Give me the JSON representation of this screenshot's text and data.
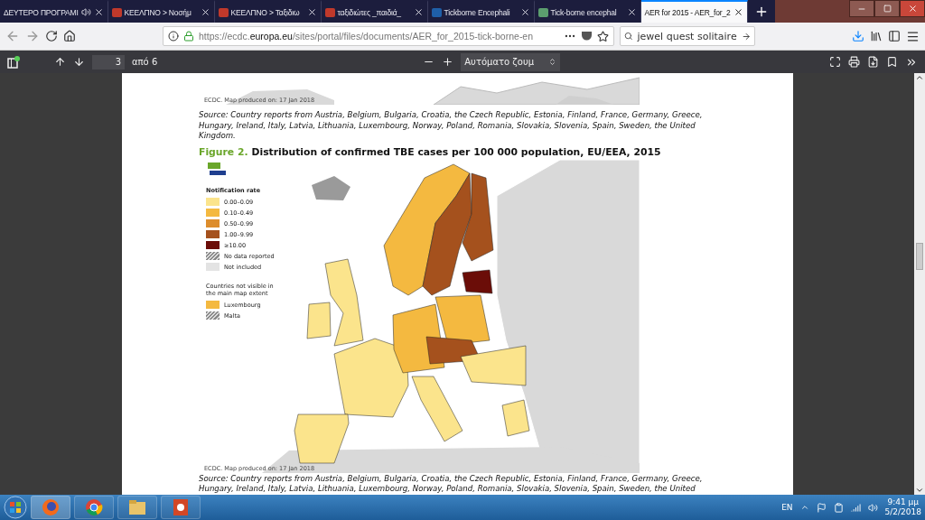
{
  "tabs": [
    {
      "title": "ΔΕΥΤΕΡΟ ΠΡΟΓΡΑΜΙ",
      "audio": true,
      "selected": false
    },
    {
      "title": "ΚΕΕΛΠΝΟ > Νοσήμ",
      "audio": false,
      "selected": false,
      "color": "#c0392b"
    },
    {
      "title": "ΚΕΕΛΠΝΟ > Ταξιδιω",
      "audio": false,
      "selected": false,
      "color": "#c0392b"
    },
    {
      "title": "ταξιδιώτες _παιδιά_",
      "audio": false,
      "selected": false,
      "color": "#c0392b"
    },
    {
      "title": "Tickborne Encephali",
      "audio": false,
      "selected": false,
      "color": "#1f5fa8"
    },
    {
      "title": "Tick-borne encephal",
      "audio": false,
      "selected": false,
      "color": "#5b9e6e"
    },
    {
      "title": "AER for 2015 - AER_for_2",
      "audio": false,
      "selected": true
    }
  ],
  "address": {
    "scheme": "https://ecdc.",
    "domain": "europa.eu",
    "path": "/sites/portal/files/documents/AER_for_2015-tick-borne-en"
  },
  "search": {
    "value": "jewel quest solitaire"
  },
  "pdf_toolbar": {
    "page": "3",
    "page_count": "από 6",
    "zoom": "Αυτόματο ζουμ"
  },
  "document": {
    "top_map_caption": "ECDC. Map produced on: 17 Jan 2018",
    "source_1": "Source: Country reports from Austria, Belgium, Bulgaria, Croatia, the Czech Republic, Estonia, Finland, France, Germany, Greece, Hungary, Ireland, Italy, Latvia, Lithuania, Luxembourg, Norway, Poland, Romania, Slovakia, Slovenia, Spain, Sweden, the United Kingdom.",
    "figure_number": "Figure 2.",
    "figure_title": "Distribution of confirmed TBE cases per 100 000 population, EU/EEA, 2015",
    "legend_title": "Notification rate",
    "legend": [
      {
        "label": "0.00–0.09",
        "kind": "swatch",
        "color": "#fbe48c"
      },
      {
        "label": "0.10–0.49",
        "kind": "swatch",
        "color": "#f4b940"
      },
      {
        "label": "0.50–0.99",
        "kind": "swatch",
        "color": "#dd8d2c"
      },
      {
        "label": "1.00–9.99",
        "kind": "swatch",
        "color": "#a5511d"
      },
      {
        "label": "≥10.00",
        "kind": "swatch",
        "color": "#6b0d08"
      },
      {
        "label": "No data reported",
        "kind": "hatched"
      },
      {
        "label": "Not included",
        "kind": "swatch",
        "color": "#e3e3e3"
      }
    ],
    "extent_title": "Countries not visible in the main map extent",
    "extent": [
      {
        "label": "Luxembourg",
        "kind": "swatch",
        "color": "#f4b940"
      },
      {
        "label": "Malta",
        "kind": "hatched"
      }
    ],
    "map_caption": "ECDC. Map produced on: 17 Jan 2018",
    "source_2": "Source: Country reports from Austria, Belgium, Bulgaria, Croatia, the Czech Republic, Estonia, Finland, France, Germany, Greece, Hungary, Ireland, Italy, Latvia, Lithuania, Luxembourg, Norway, Poland, Romania, Slovakia, Slovenia, Spain, Sweden, the United"
  },
  "taskbar": {
    "language": "EN",
    "time": "9:41 μμ",
    "date": "5/2/2018"
  }
}
